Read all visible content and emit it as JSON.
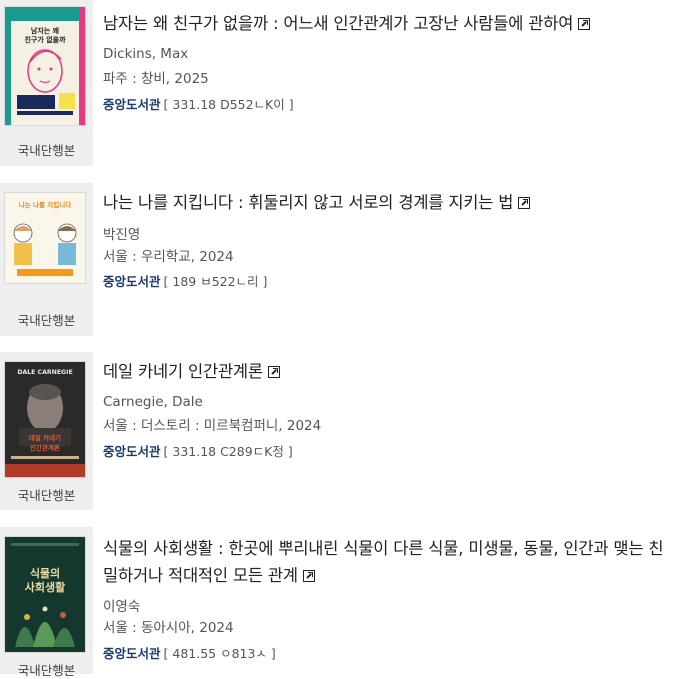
{
  "results": [
    {
      "title": "남자는 왜 친구가 없을까 : 어느새 인간관계가 고장난 사람들에 관하여",
      "author": "Dickins, Max",
      "publisher": "파주 : 창비, 2025",
      "library": "중앙도서관",
      "call_number": "[ 331.18 D552ㄴK이 ]",
      "format": "국내단행본",
      "cover_icon": "book-cover-image",
      "external_icon": "external-link-icon"
    },
    {
      "title": "나는 나를 지킵니다 : 휘둘리지 않고 서로의 경계를 지키는 법",
      "author": "박진영",
      "publisher": "서울 : 우리학교, 2024",
      "library": "중앙도서관",
      "call_number": "[ 189 ㅂ522ㄴ리 ]",
      "format": "국내단행본",
      "cover_icon": "book-cover-image",
      "external_icon": "external-link-icon"
    },
    {
      "title": "데일 카네기 인간관계론",
      "author": "Carnegie, Dale",
      "publisher": "서울 : 더스토리 : 미르북컴퍼니, 2024",
      "library": "중앙도서관",
      "call_number": "[ 331.18 C289ㄷK정 ]",
      "format": "국내단행본",
      "cover_icon": "book-cover-image",
      "external_icon": "external-link-icon"
    },
    {
      "title": "식물의 사회생활 : 한곳에 뿌리내린 식물이 다른 식물, 미생물, 동물, 인간과 맺는 친밀하거나 적대적인 모든 관계",
      "author": "이영숙",
      "publisher": "서울 : 동아시아, 2024",
      "library": "중앙도서관",
      "call_number": "[ 481.55 ㅇ813ㅅ ]",
      "format": "국내단행본",
      "cover_icon": "book-cover-image",
      "external_icon": "external-link-icon"
    }
  ],
  "covers": [
    {
      "text1": "남자는 왜",
      "text2": "친구가 없을까"
    },
    {
      "text1": "나는 나를 지킵니다"
    },
    {
      "text1": "DALE CARNEGIE",
      "text2": "데일 카네기",
      "text3": "인간관계론"
    },
    {
      "text1": "식물의",
      "text2": "사회생활"
    }
  ],
  "colors": {
    "library_link": "#1a3b6d",
    "title": "#222222",
    "thumb_bg": "#eeeeee"
  }
}
